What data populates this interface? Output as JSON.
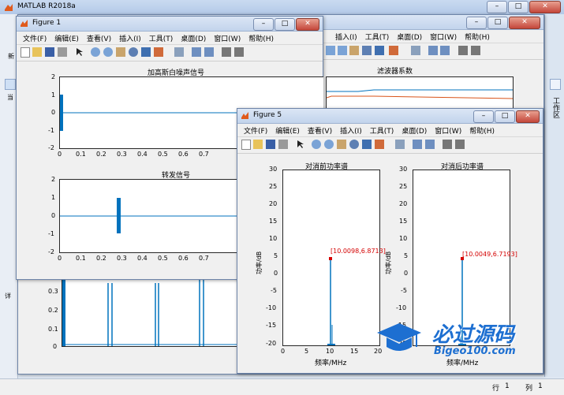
{
  "matlab": {
    "title": "MATLAB R2018a",
    "left_strip_labels": [
      "新",
      "当",
      "详"
    ],
    "workspace_tab": "工作区"
  },
  "status_bar": {
    "row_label": "行",
    "row_value": "1",
    "col_label": "列",
    "col_value": "1"
  },
  "menus": [
    "文件(F)",
    "编辑(E)",
    "查看(V)",
    "插入(I)",
    "工具(T)",
    "桌面(D)",
    "窗口(W)",
    "帮助(H)"
  ],
  "figure1": {
    "title": "Figure 1",
    "plot1_title": "加高斯白噪声信号",
    "plot1_yticks": [
      "2",
      "1",
      "0",
      "-1",
      "-2"
    ],
    "plot1_xticks": [
      "0",
      "0.1",
      "0.2",
      "0.3",
      "0.4",
      "0.5",
      "0.6",
      "0.7"
    ],
    "plot2_title": "转发信号",
    "plot2_yticks": [
      "2",
      "1",
      "0",
      "-1",
      "-2"
    ],
    "plot2_xticks": [
      "0",
      "0.1",
      "0.2",
      "0.3",
      "0.4",
      "0.5",
      "0.6",
      "0.7"
    ]
  },
  "background_figure": {
    "title": "滤波器系数",
    "menus_visible": [
      "插入(I)",
      "工具(T)",
      "桌面(D)",
      "窗口(W)",
      "帮助(H)"
    ],
    "yticks": [
      "0.3",
      "0.2",
      "0.1",
      "0"
    ]
  },
  "figure5": {
    "title": "Figure 5",
    "left_title": "对消前功率谱",
    "right_title": "对消后功率谱",
    "ylabel": "功率/dB",
    "xlabel": "频率/MHz",
    "yticks": [
      "30",
      "25",
      "20",
      "15",
      "10",
      "5",
      "0",
      "-5",
      "-10",
      "-15",
      "-20"
    ],
    "xticks": [
      "0",
      "5",
      "10",
      "15",
      "20"
    ],
    "left_datatip": "[10.0098,6.8713]",
    "right_datatip": "[10.0049,6.7193]"
  },
  "watermark": {
    "main": "必过源码",
    "sub": "Bigeo100.com"
  },
  "colors": {
    "plot_blue": "#0072bd",
    "plot_orange": "#d95319",
    "datatip_red": "#d40000"
  }
}
